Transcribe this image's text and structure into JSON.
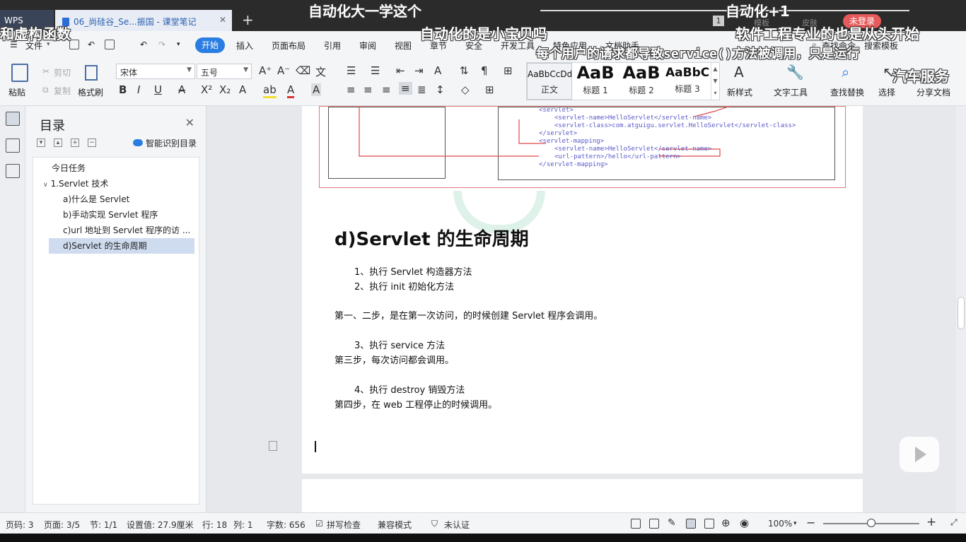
{
  "titlebar": {
    "app_name": "WPS",
    "tab_title": "06_尚硅谷_Se...振国 - 课堂笔记",
    "new_tab": "+",
    "counter": "1",
    "template": "模板",
    "skin": "皮肤",
    "login": "未登录"
  },
  "menu": {
    "file": "文件",
    "items": [
      "开始",
      "插入",
      "页面布局",
      "引用",
      "审阅",
      "视图",
      "章节",
      "安全",
      "开发工具",
      "特色应用",
      "文档助手"
    ],
    "find_command": "查找命令",
    "search_template": "搜索模板"
  },
  "ribbon": {
    "paste": "粘贴",
    "cut": "剪切",
    "copy": "复制",
    "format_painter": "格式刷",
    "font_name": "宋体",
    "font_size": "五号",
    "styles": [
      {
        "sample": "AaBbCcDd",
        "caption": "正文"
      },
      {
        "sample": "AaB",
        "caption": "标题 1"
      },
      {
        "sample": "AaB",
        "caption": "标题 2"
      },
      {
        "sample": "AaBbC",
        "caption": "标题 3"
      }
    ],
    "new_style": "新样式",
    "text_tools": "文字工具",
    "find_replace": "查找替换",
    "select": "选择",
    "share_doc": "分享文档"
  },
  "toc": {
    "title": "目录",
    "smart": "智能识别目录",
    "items": [
      {
        "label": "今日任务"
      },
      {
        "label": "1.Servlet 技术"
      },
      {
        "label": "a)什么是 Servlet"
      },
      {
        "label": "b)手动实现 Servlet 程序"
      },
      {
        "label": "c)url 地址到 Servlet 程序的访 ..."
      },
      {
        "label": "d)Servlet 的生命周期"
      }
    ]
  },
  "document": {
    "code_lines": [
      "<servlet>",
      "<servlet-name>HelloServlet</servlet-name>",
      "<servlet-class>com.atguigu.servlet.HelloServlet</servlet-class>",
      "</servlet>",
      "<servlet-mapping>",
      "<servlet-name>HelloServlet</servlet-name>",
      "<url-pattern>/hello</url-pattern>",
      "</servlet-mapping>"
    ],
    "heading": "d)Servlet 的生命周期",
    "lines": [
      "1、执行 Servlet 构造器方法",
      "2、执行 init 初始化方法",
      "第一、二步，是在第一次访问，的时候创建 Servlet 程序会调用。",
      "3、执行 service 方法",
      "第三步，每次访问都会调用。",
      "4、执行 destroy 销毁方法",
      "第四步，在 web 工程停止的时候调用。"
    ]
  },
  "status": {
    "page_num": "页码: 3",
    "pages": "页面: 3/5",
    "section": "节: 1/1",
    "setting": "设置值: 27.9厘米",
    "row": "行: 18",
    "col": "列: 1",
    "words": "字数: 656",
    "spell": "拼写检查",
    "compat": "兼容模式",
    "cert": "未认证",
    "zoom": "100%"
  },
  "danmaku": [
    "和虚构函数",
    "自动化大一学这个",
    "自动化+1",
    "自动化的是小宝贝吗",
    "软件工程专业的也是从头开始",
    "每个用户的请求都导致service()方法被调用，只是运行",
    "汽车服务"
  ]
}
